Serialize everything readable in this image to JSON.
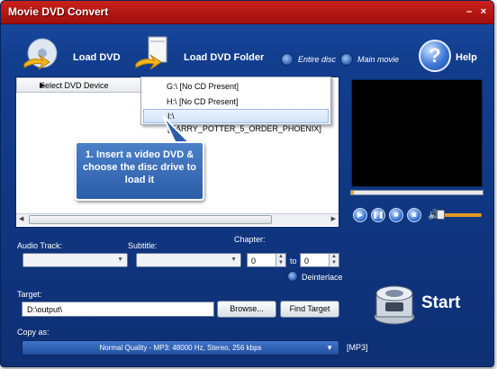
{
  "window": {
    "title": "Movie DVD Convert"
  },
  "toolbar": {
    "load_dvd": "Load DVD",
    "load_dvd_folder": "Load DVD Folder",
    "entire_disc": "Entire disc",
    "main_movie": "Main movie",
    "help": "Help"
  },
  "menu": {
    "select_device": "Select DVD Device",
    "drives": [
      "G:\\ [No CD Present]",
      "H:\\ [No CD Present]",
      "I:\\ [HARRY_POTTER_5_ORDER_PHOENIX]"
    ],
    "selected_index": 2
  },
  "callout": {
    "text": "1. Insert a video DVD & choose the disc drive to load it"
  },
  "player": {
    "progress": 0.02,
    "volume": 0.95
  },
  "options": {
    "audio_track_label": "Audio Track:",
    "subtitle_label": "Subtitle:",
    "chapter_label": "Chapter:",
    "chapter_from": "0",
    "chapter_to_label": "to",
    "chapter_to": "0",
    "deinterlace_label": "Deinterlace"
  },
  "target": {
    "label": "Target:",
    "path": "D:\\output\\",
    "browse": "Browse...",
    "find": "Find Target"
  },
  "copy_as": {
    "label": "Copy as:",
    "value": "Normal Quality - MP3: 48000 Hz, Stereo, 256 kbps",
    "format_tag": "[MP3]"
  },
  "start": {
    "label": "Start"
  },
  "colors": {
    "title_red": "#b3160f",
    "panel_blue": "#123e8f",
    "accent_orange": "#f0a020"
  }
}
